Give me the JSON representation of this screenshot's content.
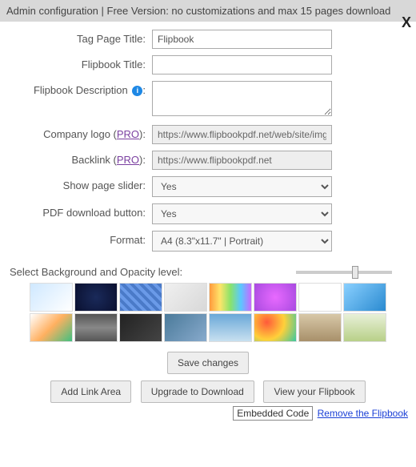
{
  "header": {
    "title": "Admin configuration | Free Version: no customizations and max 15 pages download",
    "close": "X"
  },
  "form": {
    "tag_page_title": {
      "label": "Tag Page Title:",
      "value": "Flipbook"
    },
    "flipbook_title": {
      "label": "Flipbook Title:",
      "value": ""
    },
    "flipbook_desc": {
      "label": "Flipbook Description",
      "info": "i",
      "colon": ":",
      "value": ""
    },
    "company_logo": {
      "label_pre": "Company logo (",
      "pro": "PRO",
      "label_post": "):",
      "value": "https://www.flipbookpdf.net/web/site/img/logo"
    },
    "backlink": {
      "label_pre": "Backlink (",
      "pro": "PRO",
      "label_post": "):",
      "value": "https://www.flipbookpdf.net"
    },
    "show_slider": {
      "label": "Show page slider:",
      "value": "Yes"
    },
    "pdf_download": {
      "label": "PDF download button:",
      "value": "Yes"
    },
    "format": {
      "label": "Format:",
      "value": "A4 (8.3\"x11.7\" | Portrait)"
    }
  },
  "bg": {
    "label": "Select Background and Opacity level:",
    "thumbs": [
      "linear-gradient(135deg,#cfe8ff,#fff)",
      "radial-gradient(circle,#1a2a5a,#0a1030)",
      "repeating-linear-gradient(45deg,#4a7ac8 0 4px,#6a9ae8 4px 8px)",
      "linear-gradient(135deg,#f0f0f0,#d8d8d8)",
      "linear-gradient(90deg,#ff9a3c,#ffe46a,#8ae36a,#5ac8ff,#c86aff)",
      "radial-gradient(circle,#e86aff,#a84ae0)",
      "linear-gradient(#fff,#fff)",
      "linear-gradient(135deg,#8ad0ff,#2a8ad0)",
      "linear-gradient(135deg,#fff,#ffb060,#40c080)",
      "linear-gradient(#555,#888,#555)",
      "linear-gradient(135deg,#222,#444)",
      "linear-gradient(135deg,#4a7a9a,#88aacc)",
      "linear-gradient(#6aa8d8,#c8e0f0)",
      "radial-gradient(circle at 30% 30%,#ff5a3a,#ffd03a,#3ac8a0)",
      "linear-gradient(#d8c8a8,#a8906a)",
      "linear-gradient(#e8f0d8,#b8d088)"
    ]
  },
  "buttons": {
    "save": "Save changes",
    "add_link": "Add Link Area",
    "upgrade": "Upgrade to Download",
    "view": "View your Flipbook"
  },
  "footer": {
    "embedded": "Embedded Code",
    "remove": "Remove the Flipbook"
  }
}
